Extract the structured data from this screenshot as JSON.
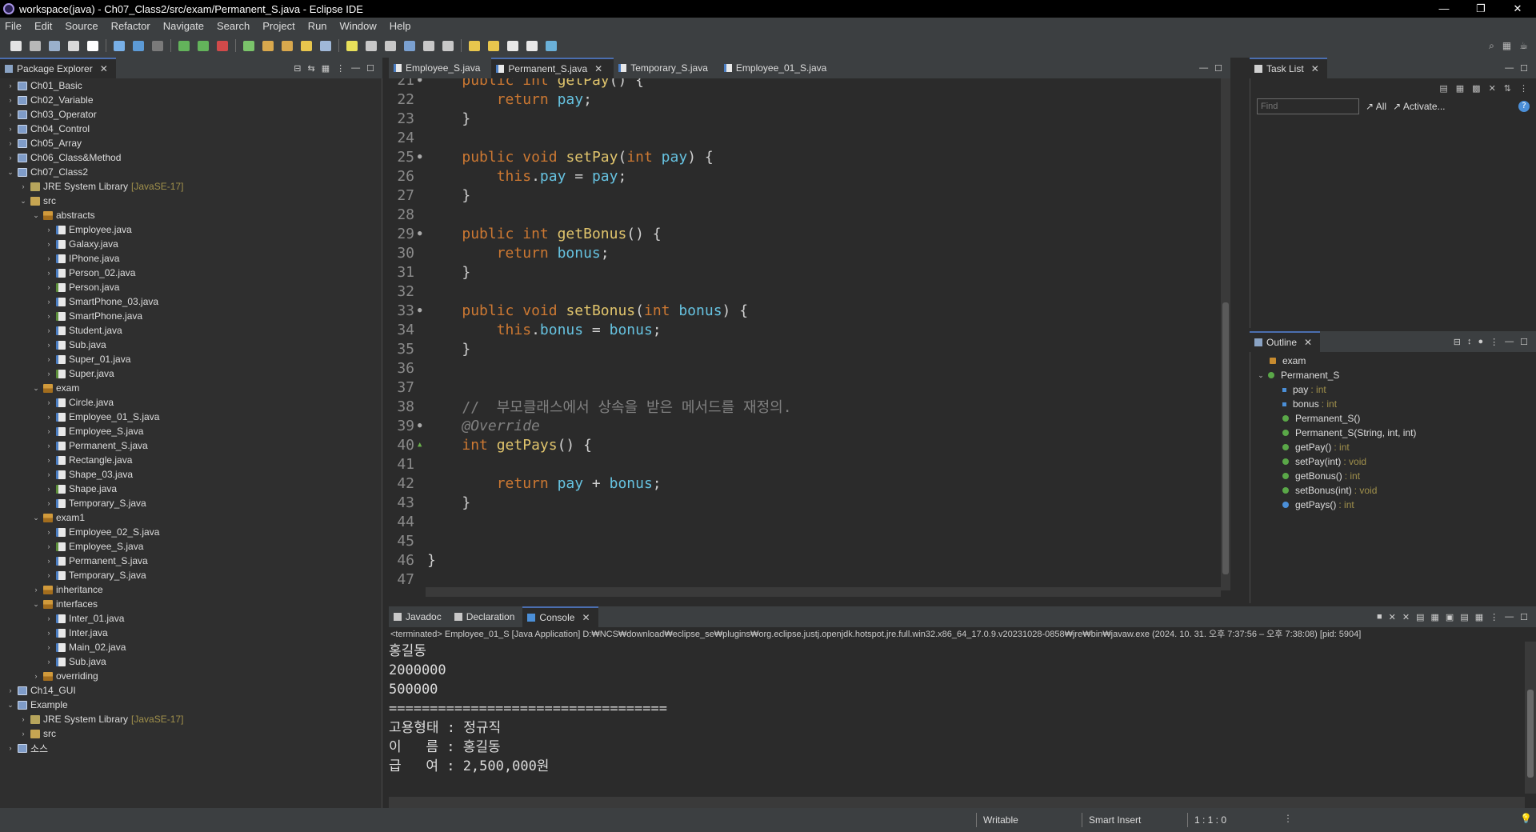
{
  "window": {
    "title": "workspace(java) - Ch07_Class2/src/exam/Permanent_S.java - Eclipse IDE",
    "min": "—",
    "max": "❐",
    "close": "✕"
  },
  "menu": [
    "File",
    "Edit",
    "Source",
    "Refactor",
    "Navigate",
    "Search",
    "Project",
    "Run",
    "Window",
    "Help"
  ],
  "explorer": {
    "tab": "Package Explorer",
    "rows": [
      {
        "label": "Ch01_Basic",
        "depth": 0,
        "tw": "›",
        "icon": "proj"
      },
      {
        "label": "Ch02_Variable",
        "depth": 0,
        "tw": "›",
        "icon": "proj"
      },
      {
        "label": "Ch03_Operator",
        "depth": 0,
        "tw": "›",
        "icon": "proj"
      },
      {
        "label": "Ch04_Control",
        "depth": 0,
        "tw": "›",
        "icon": "proj"
      },
      {
        "label": "Ch05_Array",
        "depth": 0,
        "tw": "›",
        "icon": "proj"
      },
      {
        "label": "Ch06_Class&Method",
        "depth": 0,
        "tw": "›",
        "icon": "proj"
      },
      {
        "label": "Ch07_Class2",
        "depth": 0,
        "tw": "⌄",
        "icon": "proj"
      },
      {
        "label": "JRE System Library",
        "suffix": "[JavaSE-17]",
        "depth": 1,
        "tw": "›",
        "icon": "lib"
      },
      {
        "label": "src",
        "depth": 1,
        "tw": "⌄",
        "icon": "src"
      },
      {
        "label": "abstracts",
        "depth": 2,
        "tw": "⌄",
        "icon": "pkg"
      },
      {
        "label": "Employee.java",
        "depth": 3,
        "tw": "›",
        "icon": "java"
      },
      {
        "label": "Galaxy.java",
        "depth": 3,
        "tw": "›",
        "icon": "java"
      },
      {
        "label": "IPhone.java",
        "depth": 3,
        "tw": "›",
        "icon": "java"
      },
      {
        "label": "Person_02.java",
        "depth": 3,
        "tw": "›",
        "icon": "java"
      },
      {
        "label": "Person.java",
        "depth": 3,
        "tw": "›",
        "icon": "java abs"
      },
      {
        "label": "SmartPhone_03.java",
        "depth": 3,
        "tw": "›",
        "icon": "java"
      },
      {
        "label": "SmartPhone.java",
        "depth": 3,
        "tw": "›",
        "icon": "java abs"
      },
      {
        "label": "Student.java",
        "depth": 3,
        "tw": "›",
        "icon": "java"
      },
      {
        "label": "Sub.java",
        "depth": 3,
        "tw": "›",
        "icon": "java"
      },
      {
        "label": "Super_01.java",
        "depth": 3,
        "tw": "›",
        "icon": "java"
      },
      {
        "label": "Super.java",
        "depth": 3,
        "tw": "›",
        "icon": "java abs"
      },
      {
        "label": "exam",
        "depth": 2,
        "tw": "⌄",
        "icon": "pkg"
      },
      {
        "label": "Circle.java",
        "depth": 3,
        "tw": "›",
        "icon": "java"
      },
      {
        "label": "Employee_01_S.java",
        "depth": 3,
        "tw": "›",
        "icon": "java"
      },
      {
        "label": "Employee_S.java",
        "depth": 3,
        "tw": "›",
        "icon": "java"
      },
      {
        "label": "Permanent_S.java",
        "depth": 3,
        "tw": "›",
        "icon": "java"
      },
      {
        "label": "Rectangle.java",
        "depth": 3,
        "tw": "›",
        "icon": "java"
      },
      {
        "label": "Shape_03.java",
        "depth": 3,
        "tw": "›",
        "icon": "java"
      },
      {
        "label": "Shape.java",
        "depth": 3,
        "tw": "›",
        "icon": "java abs"
      },
      {
        "label": "Temporary_S.java",
        "depth": 3,
        "tw": "›",
        "icon": "java"
      },
      {
        "label": "exam1",
        "depth": 2,
        "tw": "⌄",
        "icon": "pkg"
      },
      {
        "label": "Employee_02_S.java",
        "depth": 3,
        "tw": "›",
        "icon": "java"
      },
      {
        "label": "Employee_S.java",
        "depth": 3,
        "tw": "›",
        "icon": "java abs"
      },
      {
        "label": "Permanent_S.java",
        "depth": 3,
        "tw": "›",
        "icon": "java"
      },
      {
        "label": "Temporary_S.java",
        "depth": 3,
        "tw": "›",
        "icon": "java"
      },
      {
        "label": "inheritance",
        "depth": 2,
        "tw": "›",
        "icon": "pkg"
      },
      {
        "label": "interfaces",
        "depth": 2,
        "tw": "⌄",
        "icon": "pkg"
      },
      {
        "label": "Inter_01.java",
        "depth": 3,
        "tw": "›",
        "icon": "java"
      },
      {
        "label": "Inter.java",
        "depth": 3,
        "tw": "›",
        "icon": "java"
      },
      {
        "label": "Main_02.java",
        "depth": 3,
        "tw": "›",
        "icon": "java"
      },
      {
        "label": "Sub.java",
        "depth": 3,
        "tw": "›",
        "icon": "java"
      },
      {
        "label": "overriding",
        "depth": 2,
        "tw": "›",
        "icon": "pkg"
      },
      {
        "label": "Ch14_GUI",
        "depth": 0,
        "tw": "›",
        "icon": "proj"
      },
      {
        "label": "Example",
        "depth": 0,
        "tw": "⌄",
        "icon": "proj"
      },
      {
        "label": "JRE System Library",
        "suffix": "[JavaSE-17]",
        "depth": 1,
        "tw": "›",
        "icon": "lib"
      },
      {
        "label": "src",
        "depth": 1,
        "tw": "›",
        "icon": "src"
      },
      {
        "label": "소스",
        "depth": 0,
        "tw": "›",
        "icon": "proj"
      }
    ]
  },
  "editor": {
    "tabs": [
      {
        "label": "Employee_S.java",
        "active": false
      },
      {
        "label": "Permanent_S.java",
        "active": true
      },
      {
        "label": "Temporary_S.java",
        "active": false
      },
      {
        "label": "Employee_01_S.java",
        "active": false
      }
    ],
    "lines": [
      {
        "n": "21",
        "mark": "●",
        "code": [
          [
            "    ",
            "tx"
          ],
          [
            "public",
            "kw"
          ],
          [
            " ",
            "tx"
          ],
          [
            "int",
            "kw"
          ],
          [
            " ",
            "tx"
          ],
          [
            "getPay",
            "fn"
          ],
          [
            "() {",
            "tx"
          ]
        ]
      },
      {
        "n": "22",
        "code": [
          [
            "        ",
            "tx"
          ],
          [
            "return",
            "kw"
          ],
          [
            " ",
            "tx"
          ],
          [
            "pay",
            "var"
          ],
          [
            ";",
            "tx"
          ]
        ]
      },
      {
        "n": "23",
        "code": [
          [
            "    }",
            "tx"
          ]
        ]
      },
      {
        "n": "24",
        "code": []
      },
      {
        "n": "25",
        "mark": "●",
        "code": [
          [
            "    ",
            "tx"
          ],
          [
            "public",
            "kw"
          ],
          [
            " ",
            "tx"
          ],
          [
            "void",
            "kw"
          ],
          [
            " ",
            "tx"
          ],
          [
            "setPay",
            "fn"
          ],
          [
            "(",
            "tx"
          ],
          [
            "int",
            "kw"
          ],
          [
            " ",
            "tx"
          ],
          [
            "pay",
            "var"
          ],
          [
            ") {",
            "tx"
          ]
        ]
      },
      {
        "n": "26",
        "code": [
          [
            "        ",
            "tx"
          ],
          [
            "this",
            "kw"
          ],
          [
            ".",
            "tx"
          ],
          [
            "pay",
            "var"
          ],
          [
            " = ",
            "tx"
          ],
          [
            "pay",
            "var"
          ],
          [
            ";",
            "tx"
          ]
        ]
      },
      {
        "n": "27",
        "code": [
          [
            "    }",
            "tx"
          ]
        ]
      },
      {
        "n": "28",
        "code": []
      },
      {
        "n": "29",
        "mark": "●",
        "code": [
          [
            "    ",
            "tx"
          ],
          [
            "public",
            "kw"
          ],
          [
            " ",
            "tx"
          ],
          [
            "int",
            "kw"
          ],
          [
            " ",
            "tx"
          ],
          [
            "getBonus",
            "fn"
          ],
          [
            "() {",
            "tx"
          ]
        ]
      },
      {
        "n": "30",
        "code": [
          [
            "        ",
            "tx"
          ],
          [
            "return",
            "kw"
          ],
          [
            " ",
            "tx"
          ],
          [
            "bonus",
            "var"
          ],
          [
            ";",
            "tx"
          ]
        ]
      },
      {
        "n": "31",
        "code": [
          [
            "    }",
            "tx"
          ]
        ]
      },
      {
        "n": "32",
        "code": []
      },
      {
        "n": "33",
        "mark": "●",
        "code": [
          [
            "    ",
            "tx"
          ],
          [
            "public",
            "kw"
          ],
          [
            " ",
            "tx"
          ],
          [
            "void",
            "kw"
          ],
          [
            " ",
            "tx"
          ],
          [
            "setBonus",
            "fn"
          ],
          [
            "(",
            "tx"
          ],
          [
            "int",
            "kw"
          ],
          [
            " ",
            "tx"
          ],
          [
            "bonus",
            "var"
          ],
          [
            ") {",
            "tx"
          ]
        ]
      },
      {
        "n": "34",
        "code": [
          [
            "        ",
            "tx"
          ],
          [
            "this",
            "kw"
          ],
          [
            ".",
            "tx"
          ],
          [
            "bonus",
            "var"
          ],
          [
            " = ",
            "tx"
          ],
          [
            "bonus",
            "var"
          ],
          [
            ";",
            "tx"
          ]
        ]
      },
      {
        "n": "35",
        "code": [
          [
            "    }",
            "tx"
          ]
        ]
      },
      {
        "n": "36",
        "code": []
      },
      {
        "n": "37",
        "code": []
      },
      {
        "n": "38",
        "code": [
          [
            "    ",
            "tx"
          ],
          [
            "//  부모클래스에서 상속을 받은 메서드를 재정의.",
            "cm"
          ]
        ]
      },
      {
        "n": "39",
        "mark": "●",
        "code": [
          [
            "    ",
            "tx"
          ],
          [
            "@Override",
            "an"
          ]
        ]
      },
      {
        "n": "40",
        "mark": "▲",
        "code": [
          [
            "    ",
            "tx"
          ],
          [
            "int",
            "kw"
          ],
          [
            " ",
            "tx"
          ],
          [
            "getPays",
            "fn"
          ],
          [
            "() {",
            "tx"
          ]
        ]
      },
      {
        "n": "41",
        "code": []
      },
      {
        "n": "42",
        "code": [
          [
            "        ",
            "tx"
          ],
          [
            "return",
            "kw"
          ],
          [
            " ",
            "tx"
          ],
          [
            "pay",
            "var"
          ],
          [
            " + ",
            "tx"
          ],
          [
            "bonus",
            "var"
          ],
          [
            ";",
            "tx"
          ]
        ]
      },
      {
        "n": "43",
        "code": [
          [
            "    }",
            "tx"
          ]
        ]
      },
      {
        "n": "44",
        "code": []
      },
      {
        "n": "45",
        "code": []
      },
      {
        "n": "46",
        "code": [
          [
            "}",
            "tx"
          ]
        ]
      },
      {
        "n": "47",
        "code": []
      }
    ]
  },
  "tasklist": {
    "tab": "Task List",
    "find_placeholder": "Find",
    "all": "All",
    "activate": "Activate..."
  },
  "outline": {
    "tab": "Outline",
    "rows": [
      {
        "label": "exam",
        "type": "",
        "depth": 0,
        "icon": "pkg"
      },
      {
        "label": "Permanent_S",
        "type": "",
        "depth": 0,
        "icon": "class",
        "tw": "⌄"
      },
      {
        "label": "pay",
        "type": " : int",
        "depth": 1,
        "icon": "field"
      },
      {
        "label": "bonus",
        "type": " : int",
        "depth": 1,
        "icon": "field"
      },
      {
        "label": "Permanent_S()",
        "type": "",
        "depth": 1,
        "icon": "ctor"
      },
      {
        "label": "Permanent_S(String, int, int)",
        "type": "",
        "depth": 1,
        "icon": "ctor"
      },
      {
        "label": "getPay()",
        "type": " : int",
        "depth": 1,
        "icon": "method"
      },
      {
        "label": "setPay(int)",
        "type": " : void",
        "depth": 1,
        "icon": "method"
      },
      {
        "label": "getBonus()",
        "type": " : int",
        "depth": 1,
        "icon": "method"
      },
      {
        "label": "setBonus(int)",
        "type": " : void",
        "depth": 1,
        "icon": "method"
      },
      {
        "label": "getPays()",
        "type": " : int",
        "depth": 1,
        "icon": "override"
      }
    ]
  },
  "bottom": {
    "tabs": [
      {
        "label": "Javadoc",
        "active": false
      },
      {
        "label": "Declaration",
        "active": false
      },
      {
        "label": "Console",
        "active": true
      }
    ],
    "terminated": "<terminated> Employee_01_S [Java Application] D:₩NCS₩download₩eclipse_se₩plugins₩org.eclipse.justj.openjdk.hotspot.jre.full.win32.x86_64_17.0.9.v20231028-0858₩jre₩bin₩javaw.exe  (2024. 10. 31. 오후 7:37:56 – 오후 7:38:08) [pid: 5904]",
    "output": [
      "홍길동",
      "2000000",
      "500000",
      "==================================",
      "고용형태 : 정규직",
      "이   름 : 홍길동",
      "급   여 : 2,500,000원"
    ]
  },
  "status": {
    "writable": "Writable",
    "insert": "Smart Insert",
    "position": "1 : 1 : 0"
  },
  "colors": {
    "keyword": "#cc7832",
    "method": "#e0c46c",
    "field": "#66c2e0",
    "comment": "#808080",
    "active_tab": "#4b6eaf"
  }
}
